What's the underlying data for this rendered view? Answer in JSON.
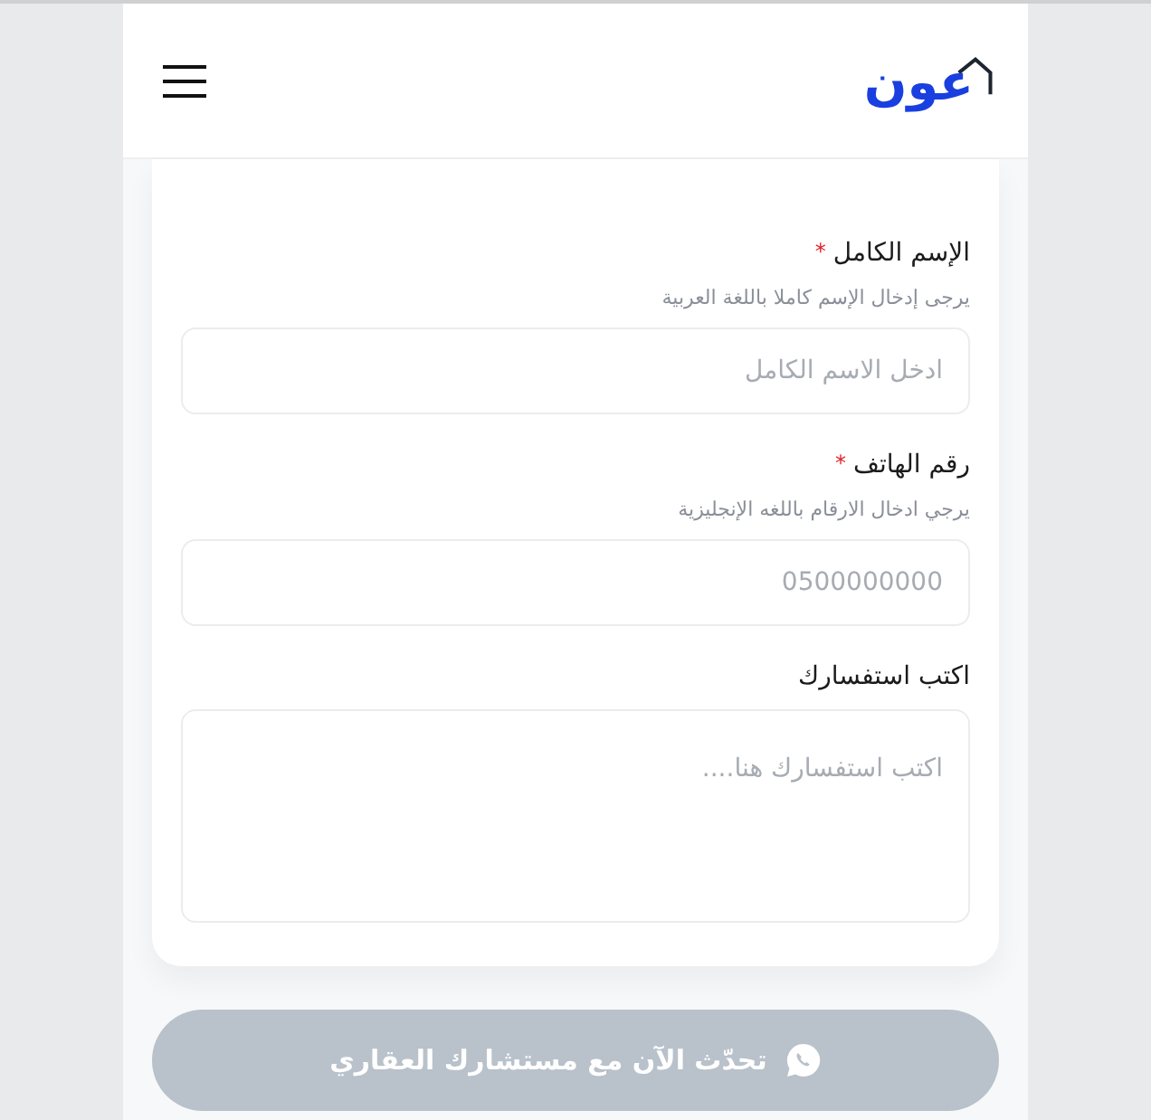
{
  "header": {
    "logo": "عون"
  },
  "form": {
    "fields": [
      {
        "kind": "input",
        "label": "الإسم الكامل",
        "required_mark": "*",
        "hint": "يرجى إدخال الإسم كاملا باللغة العربية",
        "placeholder": "ادخل الاسم الكامل"
      },
      {
        "kind": "input",
        "label": "رقم الهاتف",
        "required_mark": "*",
        "hint": "يرجي ادخال الارقام باللغه الإنجليزية",
        "placeholder": "0500000000"
      },
      {
        "kind": "textarea",
        "label": "اكتب استفسارك",
        "placeholder": "اكتب استفسارك هنا...."
      }
    ]
  },
  "whatsapp_button": {
    "label": "تحدّث الآن مع مستشارك العقاري",
    "disabled": true
  }
}
